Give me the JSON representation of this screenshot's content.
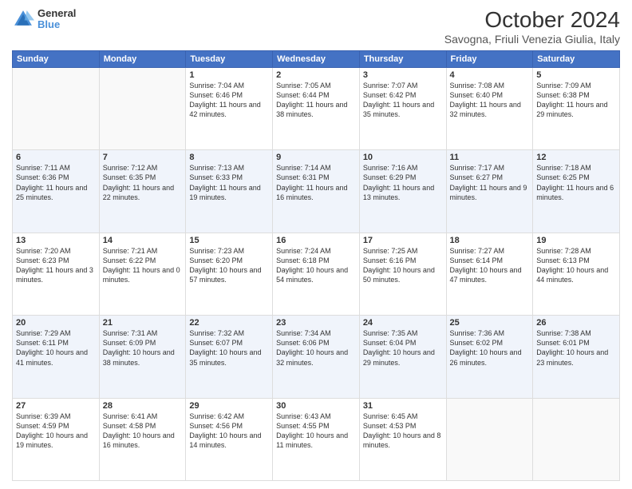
{
  "header": {
    "logo_line1": "General",
    "logo_line2": "Blue",
    "title": "October 2024",
    "subtitle": "Savogna, Friuli Venezia Giulia, Italy"
  },
  "columns": [
    "Sunday",
    "Monday",
    "Tuesday",
    "Wednesday",
    "Thursday",
    "Friday",
    "Saturday"
  ],
  "weeks": [
    [
      {
        "day": "",
        "info": ""
      },
      {
        "day": "",
        "info": ""
      },
      {
        "day": "1",
        "info": "Sunrise: 7:04 AM\nSunset: 6:46 PM\nDaylight: 11 hours and 42 minutes."
      },
      {
        "day": "2",
        "info": "Sunrise: 7:05 AM\nSunset: 6:44 PM\nDaylight: 11 hours and 38 minutes."
      },
      {
        "day": "3",
        "info": "Sunrise: 7:07 AM\nSunset: 6:42 PM\nDaylight: 11 hours and 35 minutes."
      },
      {
        "day": "4",
        "info": "Sunrise: 7:08 AM\nSunset: 6:40 PM\nDaylight: 11 hours and 32 minutes."
      },
      {
        "day": "5",
        "info": "Sunrise: 7:09 AM\nSunset: 6:38 PM\nDaylight: 11 hours and 29 minutes."
      }
    ],
    [
      {
        "day": "6",
        "info": "Sunrise: 7:11 AM\nSunset: 6:36 PM\nDaylight: 11 hours and 25 minutes."
      },
      {
        "day": "7",
        "info": "Sunrise: 7:12 AM\nSunset: 6:35 PM\nDaylight: 11 hours and 22 minutes."
      },
      {
        "day": "8",
        "info": "Sunrise: 7:13 AM\nSunset: 6:33 PM\nDaylight: 11 hours and 19 minutes."
      },
      {
        "day": "9",
        "info": "Sunrise: 7:14 AM\nSunset: 6:31 PM\nDaylight: 11 hours and 16 minutes."
      },
      {
        "day": "10",
        "info": "Sunrise: 7:16 AM\nSunset: 6:29 PM\nDaylight: 11 hours and 13 minutes."
      },
      {
        "day": "11",
        "info": "Sunrise: 7:17 AM\nSunset: 6:27 PM\nDaylight: 11 hours and 9 minutes."
      },
      {
        "day": "12",
        "info": "Sunrise: 7:18 AM\nSunset: 6:25 PM\nDaylight: 11 hours and 6 minutes."
      }
    ],
    [
      {
        "day": "13",
        "info": "Sunrise: 7:20 AM\nSunset: 6:23 PM\nDaylight: 11 hours and 3 minutes."
      },
      {
        "day": "14",
        "info": "Sunrise: 7:21 AM\nSunset: 6:22 PM\nDaylight: 11 hours and 0 minutes."
      },
      {
        "day": "15",
        "info": "Sunrise: 7:23 AM\nSunset: 6:20 PM\nDaylight: 10 hours and 57 minutes."
      },
      {
        "day": "16",
        "info": "Sunrise: 7:24 AM\nSunset: 6:18 PM\nDaylight: 10 hours and 54 minutes."
      },
      {
        "day": "17",
        "info": "Sunrise: 7:25 AM\nSunset: 6:16 PM\nDaylight: 10 hours and 50 minutes."
      },
      {
        "day": "18",
        "info": "Sunrise: 7:27 AM\nSunset: 6:14 PM\nDaylight: 10 hours and 47 minutes."
      },
      {
        "day": "19",
        "info": "Sunrise: 7:28 AM\nSunset: 6:13 PM\nDaylight: 10 hours and 44 minutes."
      }
    ],
    [
      {
        "day": "20",
        "info": "Sunrise: 7:29 AM\nSunset: 6:11 PM\nDaylight: 10 hours and 41 minutes."
      },
      {
        "day": "21",
        "info": "Sunrise: 7:31 AM\nSunset: 6:09 PM\nDaylight: 10 hours and 38 minutes."
      },
      {
        "day": "22",
        "info": "Sunrise: 7:32 AM\nSunset: 6:07 PM\nDaylight: 10 hours and 35 minutes."
      },
      {
        "day": "23",
        "info": "Sunrise: 7:34 AM\nSunset: 6:06 PM\nDaylight: 10 hours and 32 minutes."
      },
      {
        "day": "24",
        "info": "Sunrise: 7:35 AM\nSunset: 6:04 PM\nDaylight: 10 hours and 29 minutes."
      },
      {
        "day": "25",
        "info": "Sunrise: 7:36 AM\nSunset: 6:02 PM\nDaylight: 10 hours and 26 minutes."
      },
      {
        "day": "26",
        "info": "Sunrise: 7:38 AM\nSunset: 6:01 PM\nDaylight: 10 hours and 23 minutes."
      }
    ],
    [
      {
        "day": "27",
        "info": "Sunrise: 6:39 AM\nSunset: 4:59 PM\nDaylight: 10 hours and 19 minutes."
      },
      {
        "day": "28",
        "info": "Sunrise: 6:41 AM\nSunset: 4:58 PM\nDaylight: 10 hours and 16 minutes."
      },
      {
        "day": "29",
        "info": "Sunrise: 6:42 AM\nSunset: 4:56 PM\nDaylight: 10 hours and 14 minutes."
      },
      {
        "day": "30",
        "info": "Sunrise: 6:43 AM\nSunset: 4:55 PM\nDaylight: 10 hours and 11 minutes."
      },
      {
        "day": "31",
        "info": "Sunrise: 6:45 AM\nSunset: 4:53 PM\nDaylight: 10 hours and 8 minutes."
      },
      {
        "day": "",
        "info": ""
      },
      {
        "day": "",
        "info": ""
      }
    ]
  ]
}
